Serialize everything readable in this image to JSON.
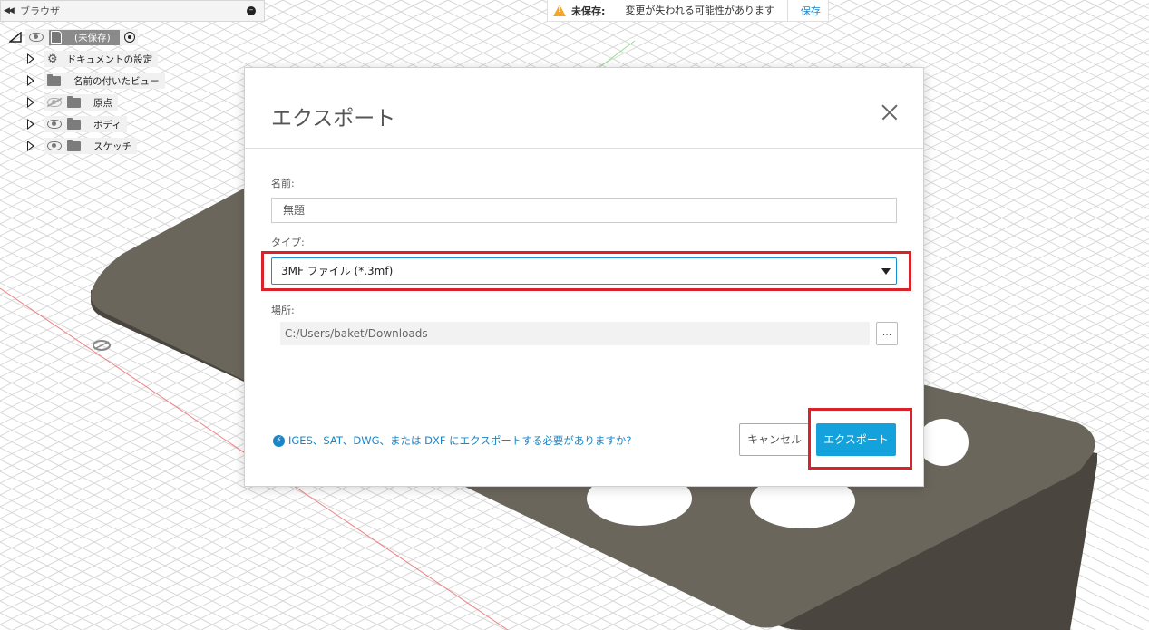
{
  "browser": {
    "title": "ブラウザ",
    "root_label": "(未保存)",
    "items": [
      {
        "label": "ドキュメントの設定",
        "icon": "gear-icon"
      },
      {
        "label": "名前の付いたビュー",
        "icon": "folder-icon"
      },
      {
        "label": "原点",
        "icon": "folder-icon",
        "visible": false
      },
      {
        "label": "ボディ",
        "icon": "folder-icon",
        "visible": true
      },
      {
        "label": "スケッチ",
        "icon": "folder-icon",
        "visible": true
      }
    ]
  },
  "unsaved_banner": {
    "label": "未保存:",
    "message": "変更が失われる可能性があります",
    "save_link": "保存"
  },
  "dialog": {
    "title": "エクスポート",
    "name_label": "名前:",
    "name_value": "無題",
    "type_label": "タイプ:",
    "type_value": "3MF ファイル (*.3mf)",
    "location_label": "場所:",
    "location_value": "C:/Users/baket/Downloads",
    "browse_label": "...",
    "help_link": "IGES、SAT、DWG、または DXF にエクスポートする必要がありますか?",
    "cancel_label": "キャンセル",
    "export_label": "エクスポート"
  },
  "colors": {
    "accent": "#13a2dc",
    "link": "#1a86c8",
    "highlight": "#d9222a",
    "warning": "#f5a623",
    "part": "#6b665c"
  }
}
